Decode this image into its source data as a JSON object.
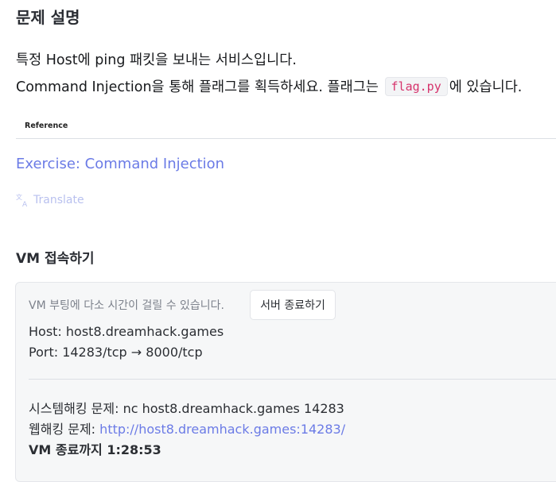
{
  "section_title": "문제 설명",
  "description": {
    "line1": "특정 Host에 ping 패킷을 보내는 서비스입니다.",
    "line2_before": "Command Injection을 통해 플래그를 획득하세요. 플래그는 ",
    "line2_code": "flag.py",
    "line2_after": "에 있습니다."
  },
  "reference": {
    "label": "Reference",
    "link_text": "Exercise: Command Injection"
  },
  "translate_label": "Translate",
  "vm": {
    "title": "VM 접속하기",
    "boot_note": "VM 부팅에 다소 시간이 걸릴 수 있습니다.",
    "stop_button": "서버 종료하기",
    "host_line": "Host: host8.dreamhack.games",
    "port_line": "Port:  14283/tcp → 8000/tcp",
    "system_line": "시스템해킹 문제: nc host8.dreamhack.games 14283",
    "web_prefix": "웹해킹 문제: ",
    "web_link": "http://host8.dreamhack.games:14283/",
    "remaining": "VM 종료까지 1:28:53"
  },
  "colors": {
    "link": "#6b7be6",
    "code_text": "#d6336c"
  }
}
